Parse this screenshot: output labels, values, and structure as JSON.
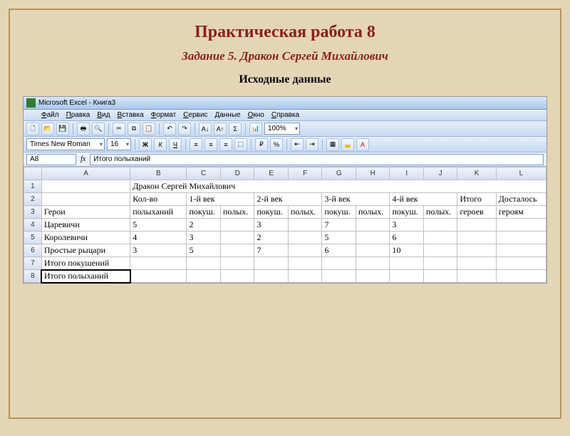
{
  "page": {
    "title": "Практическая работа 8",
    "subtitle": "Задание 5. Дракон Сергей Михайлович",
    "caption": "Исходные данные"
  },
  "excel": {
    "app_title": "Microsoft Excel - Книга3",
    "menu": [
      "Файл",
      "Правка",
      "Вид",
      "Вставка",
      "Формат",
      "Сервис",
      "Данные",
      "Окно",
      "Справка"
    ],
    "font_name": "Times New Roman",
    "font_size": "16",
    "zoom": "100%",
    "btn_bold": "Ж",
    "btn_italic": "К",
    "btn_underline": "Ч",
    "sigma": "Σ",
    "cell_ref": "A8",
    "fx_label": "fx",
    "formula_bar": "Итого полыханий",
    "cols": [
      "A",
      "B",
      "C",
      "D",
      "E",
      "F",
      "G",
      "H",
      "I",
      "J",
      "K",
      "L"
    ],
    "rows": [
      "1",
      "2",
      "3",
      "4",
      "5",
      "6",
      "7",
      "8"
    ]
  },
  "table": {
    "row1_title": "Дракон Сергей Михайлович",
    "row2": {
      "b": "Кол-во",
      "cd": "1-й век",
      "ef": "2-й век",
      "gh": "3-й век",
      "ij": "4-й век",
      "k": "Итого",
      "l": "Досталось"
    },
    "row3": {
      "a": "Герои",
      "b": "полыханий",
      "c": "покуш.",
      "d": "полых.",
      "e": "покуш.",
      "f": "полых.",
      "g": "покуш.",
      "h": "полых.",
      "i": "покуш.",
      "j": "полых.",
      "k": "героев",
      "l": "героям"
    },
    "data": [
      {
        "a": "Царевичи",
        "b": "5",
        "c": "2",
        "e": "3",
        "g": "7",
        "i": "3"
      },
      {
        "a": "Королевичи",
        "b": "4",
        "c": "3",
        "e": "2",
        "g": "5",
        "i": "6"
      },
      {
        "a": "Простые рыцари",
        "b": "3",
        "c": "5",
        "e": "7",
        "g": "6",
        "i": "10"
      }
    ],
    "row7_a": "Итого покушений",
    "row8_a": "Итого полыханий"
  },
  "chart_data": {
    "type": "table",
    "title": "Дракон Сергей Михайлович",
    "columns": [
      "Герои",
      "Кол-во полыханий",
      "1-й век покуш.",
      "1-й век полых.",
      "2-й век покуш.",
      "2-й век полых.",
      "3-й век покуш.",
      "3-й век полых.",
      "4-й век покуш.",
      "4-й век полых.",
      "Итого героев",
      "Досталось героям"
    ],
    "rows": [
      [
        "Царевичи",
        5,
        2,
        null,
        3,
        null,
        7,
        null,
        3,
        null,
        null,
        null
      ],
      [
        "Королевичи",
        4,
        3,
        null,
        2,
        null,
        5,
        null,
        6,
        null,
        null,
        null
      ],
      [
        "Простые рыцари",
        3,
        5,
        null,
        7,
        null,
        6,
        null,
        10,
        null,
        null,
        null
      ],
      [
        "Итого покушений",
        null,
        null,
        null,
        null,
        null,
        null,
        null,
        null,
        null,
        null,
        null
      ],
      [
        "Итого полыханий",
        null,
        null,
        null,
        null,
        null,
        null,
        null,
        null,
        null,
        null,
        null
      ]
    ]
  }
}
